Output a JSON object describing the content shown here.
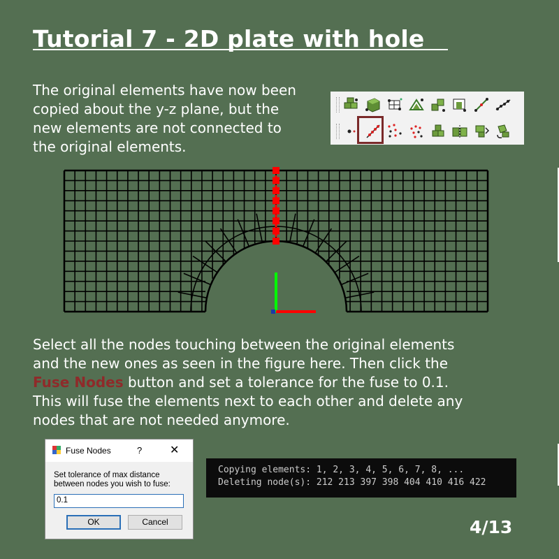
{
  "title": "Tutorial 7 - 2D plate with hole  ",
  "intro_text": "The original elements have now been\ncopied about the y-z plane, but the\nnew elements are not connected to\nthe original elements.",
  "instructions": {
    "part1": "Select all the nodes touching between the original elements\nand the new ones as seen in the figure here. Then click the\n",
    "highlight": "Fuse Nodes",
    "part2": " button and set a tolerance for the fuse to 0.1.\nThis will fuse the elements next to each other and delete any\nnodes that are not needed anymore."
  },
  "colors": {
    "background": "#546f52",
    "highlight": "#8f2a2a",
    "selected_nodes": "#ff0000",
    "axis_y": "#00ff00",
    "axis_z": "#ff0000",
    "mesh_lines": "#000000"
  },
  "toolbar": {
    "row1_icons": [
      "element-cube-icon",
      "solid-cube-icon",
      "mesh-block-icon",
      "triangle-points-icon",
      "transform-cubes-icon",
      "copy-element-icon",
      "line-nodes-icon",
      "node-chain-icon"
    ],
    "row2_icons": [
      "single-node-icon",
      "fuse-nodes-icon",
      "scatter-nodes-icon",
      "delete-nodes-icon",
      "stacked-cubes-icon",
      "mirror-cubes-icon",
      "extrude-cubes-icon",
      "rotate-cubes-icon"
    ],
    "selected": "fuse-nodes-icon"
  },
  "dialog": {
    "title": "Fuse Nodes",
    "help": "?",
    "close": "✕",
    "message": "Set tolerance of max distance\nbetween nodes you wish to fuse:",
    "input_value": "0.1",
    "ok_label": "OK",
    "cancel_label": "Cancel"
  },
  "console": {
    "lines": [
      "Copying elements: 1, 2, 3, 4, 5, 6, 7, 8, ...",
      "Deleting node(s): 212 213 397 398 404 410 416 422"
    ]
  },
  "page_number": "4/13"
}
